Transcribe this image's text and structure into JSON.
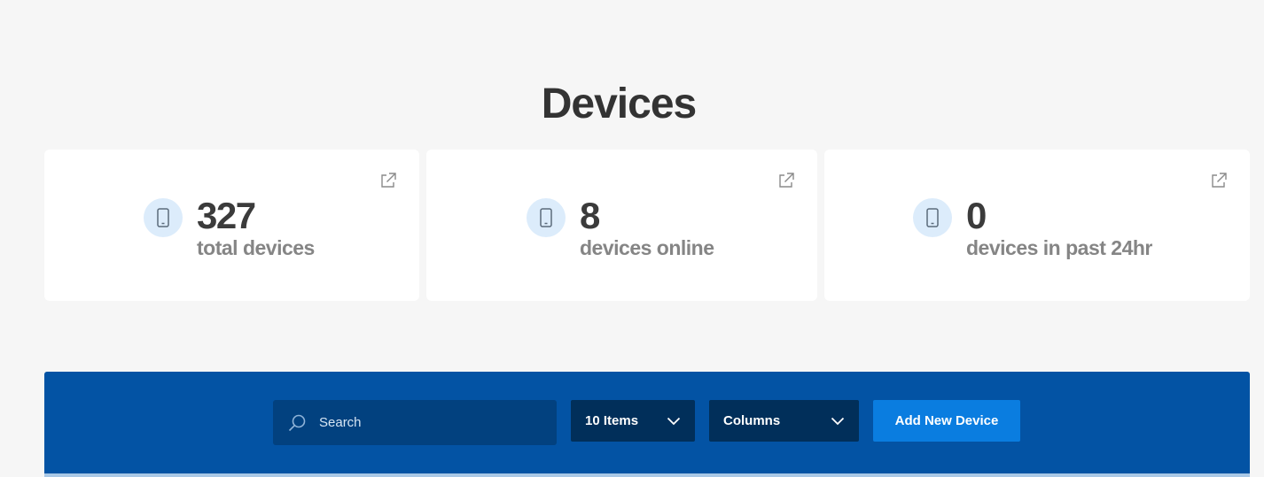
{
  "page": {
    "title": "Devices"
  },
  "stats": [
    {
      "value": "327",
      "label": "total devices",
      "icon": "mobile-device-icon",
      "link_icon": "external-link-icon"
    },
    {
      "value": "8",
      "label": "devices online",
      "icon": "mobile-device-icon",
      "link_icon": "external-link-icon"
    },
    {
      "value": "0",
      "label": "devices in past 24hr",
      "icon": "mobile-device-icon",
      "link_icon": "external-link-icon"
    }
  ],
  "toolbar": {
    "search_placeholder": "Search",
    "search_icon": "search-icon",
    "items_select": {
      "selected": "10 Items",
      "icon": "chevron-down-icon"
    },
    "columns_select": {
      "selected": "Columns",
      "icon": "chevron-down-icon"
    },
    "add_button_label": "Add New Device"
  },
  "colors": {
    "page_background": "#f6f6f6",
    "card_background": "#ffffff",
    "toolbar_background": "#0353a4",
    "search_background": "#02417f",
    "select_background": "#012f5a",
    "primary_button": "#0a7de0",
    "icon_circle": "#dcecfb"
  }
}
